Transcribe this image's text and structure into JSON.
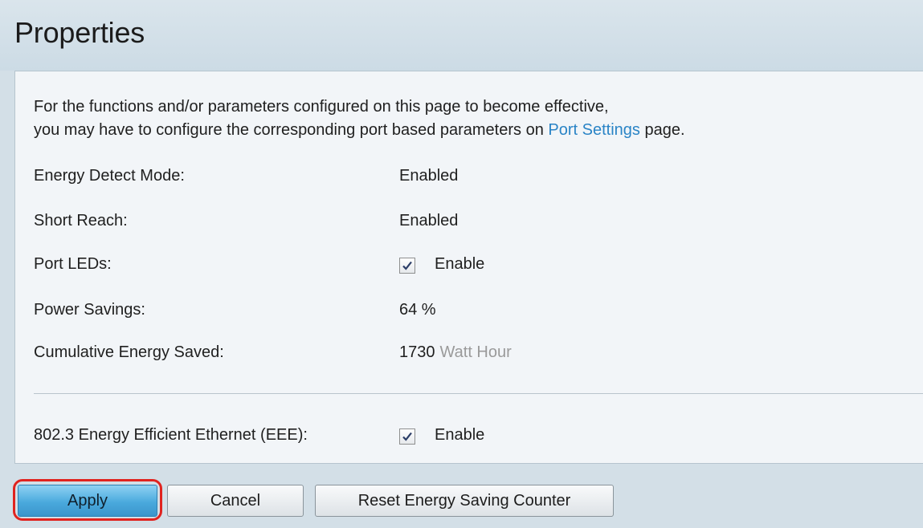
{
  "page": {
    "title": "Properties"
  },
  "info": {
    "line1": "For the functions and/or parameters configured on this page to become effective,",
    "line2_prefix": "you may have to configure the corresponding port based parameters on ",
    "link": "Port Settings",
    "line2_suffix": " page."
  },
  "rows": {
    "energy_detect": {
      "label": "Energy Detect Mode:",
      "value": "Enabled"
    },
    "short_reach": {
      "label": "Short Reach:",
      "value": "Enabled"
    },
    "port_leds": {
      "label": "Port LEDs:",
      "checked": true,
      "check_label": "Enable"
    },
    "power_savings": {
      "label": "Power Savings:",
      "value": "64 %"
    },
    "cumulative": {
      "label": "Cumulative Energy Saved:",
      "value": "1730",
      "unit": "Watt Hour"
    },
    "eee": {
      "label": "802.3 Energy Efficient Ethernet (EEE):",
      "checked": true,
      "check_label": "Enable"
    }
  },
  "buttons": {
    "apply": "Apply",
    "cancel": "Cancel",
    "reset": "Reset Energy Saving Counter"
  },
  "colors": {
    "link": "#2a84c6",
    "apply_button": "#4aa9dd",
    "highlight_ring": "#e0231f"
  }
}
